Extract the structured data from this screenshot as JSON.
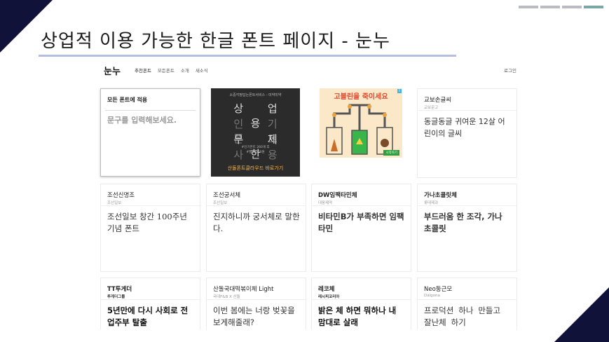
{
  "slide": {
    "title": "상업적 이용 가능한 한글 폰트 페이지 - 눈누"
  },
  "site": {
    "logo": "눈누",
    "menu": [
      "추천폰트",
      "모든폰트",
      "소개",
      "새소식"
    ],
    "login": "로그인"
  },
  "apply_card": {
    "label": "모든 폰트에 적용",
    "placeholder": "문구를 입력해보세요."
  },
  "ad_dark": {
    "top_text": "소중각정답는폰트서비스 - 미약미약",
    "lines": [
      "상 업 용",
      "인 기 폰 트",
      "무 제 한",
      "사 용"
    ],
    "note_1": "#인기폰트 260개 후",
    "note_2": "#월 4,500원",
    "cta": "산돌폰트클라우드 바로가기"
  },
  "ad_game": {
    "headline": "고블린을 죽이세요",
    "button": "시작하기"
  },
  "fonts": [
    {
      "name": "교보손글씨",
      "author": "교보문고",
      "sample": "동글동글 귀여운 12살 어린이의 글씨"
    },
    {
      "name": "조선신명조",
      "author": "조선일보",
      "sample": "조선일보 창간 100주년 기념 폰트"
    },
    {
      "name": "조선궁서체",
      "author": "조선일보",
      "sample": "진지하니까 궁서체로 말한다."
    },
    {
      "name": "DW임팩타민체",
      "author": "대웅제약",
      "sample": "비타민B가 부족하면 임팩타민"
    },
    {
      "name": "가나초콜릿체",
      "author": "롯데제과",
      "sample": "부드러움 한 조각, 가나 초콜릿"
    },
    {
      "name": "TT투게더",
      "author": "투게더그룹",
      "sample": "5년만에 다시 사회로 전업주부 탈출"
    },
    {
      "name": "산돌국대떡볶이체 Light",
      "author": "국대F&B X 산돌",
      "sample": "이번 봄에는 너랑 벚꽃을 보게해줄래?"
    },
    {
      "name": "레코체",
      "author": "레시피코리아",
      "sample": "밝은 체 하면 뭐하나 내 맘대로 살래"
    },
    {
      "name": "Neo둥근모",
      "author": "Dalgona",
      "sample": "프로덕션 하나 만들고 잘난체 하기"
    }
  ],
  "colors": {
    "corner": "#10123a",
    "underline": "#b5bde3",
    "tab_active": "#7da6a6"
  }
}
